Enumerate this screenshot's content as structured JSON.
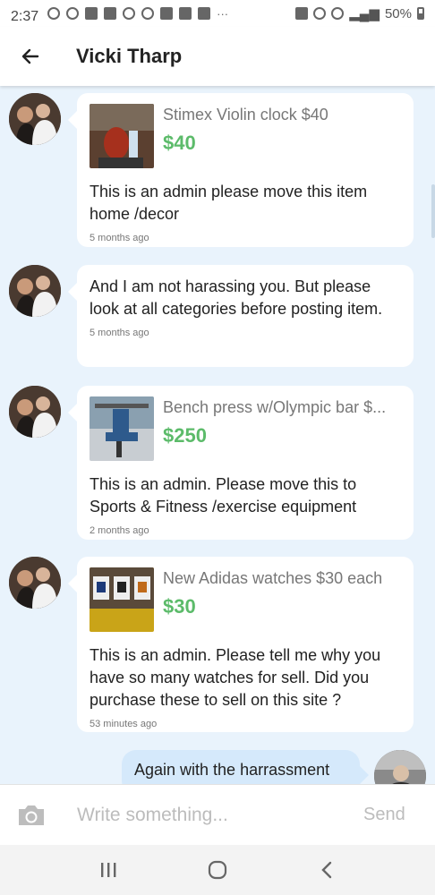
{
  "status_bar": {
    "time": "2:37",
    "battery": "50%"
  },
  "header": {
    "title": "Vicki Tharp"
  },
  "messages": [
    {
      "item": {
        "title": "Stimex Violin clock $40",
        "price": "$40"
      },
      "text": "This is an admin please move this item home /decor",
      "time": "5 months ago"
    },
    {
      "text": "And I am not harassing you.  But please look at all categories before posting item.",
      "time": "5 months ago"
    },
    {
      "item": {
        "title": "Bench press w/Olympic bar $...",
        "price": "$250"
      },
      "text": "This is an admin. Please move this to Sports & Fitness /exercise equipment",
      "time": "2 months ago"
    },
    {
      "item": {
        "title": "New Adidas watches $30 each",
        "price": "$30"
      },
      "text": "This is an admin. Please tell me why you have so many watches for sell.   Did you purchase these to sell on this site ?",
      "time": "53 minutes ago"
    }
  ],
  "outgoing": {
    "text": "Again with the harrassment"
  },
  "compose": {
    "placeholder": "Write something...",
    "send_label": "Send"
  },
  "colors": {
    "price": "#5cbb6a",
    "background": "#e9f3fc",
    "outgoing_bubble": "#d5e9fb"
  }
}
